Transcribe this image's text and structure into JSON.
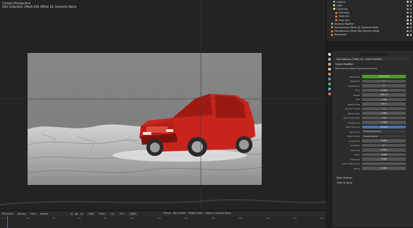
{
  "viewport": {
    "mode": "Camera Perspective",
    "subtitle": "(44) Collection | Mesh.001 Offset 16, Semente Noise"
  },
  "timeline": {
    "menus": [
      "Playback",
      "Keying",
      "View",
      "Marker"
    ],
    "start_label": "Start",
    "start_value": "1",
    "end_label": "End",
    "end_value": "250",
    "current_frame": "44",
    "ticks": [
      "0",
      "20",
      "40",
      "60",
      "80",
      "100",
      "120",
      "140",
      "160",
      "180",
      "200",
      "220",
      "240"
    ]
  },
  "status": {
    "items": [
      "Select",
      "Box Select",
      "Rotate View",
      "Object Context Menu"
    ]
  },
  "outliner": {
    "rows": [
      {
        "indent": 2,
        "label": "Camera",
        "color": "#7aa0c8"
      },
      {
        "indent": 2,
        "label": "Light",
        "color": "#e0c060"
      },
      {
        "indent": 2,
        "label": "Collection",
        "color": "#d8d8d8"
      },
      {
        "indent": 3,
        "label": "Esquerdo",
        "color": "#e07a2b"
      },
      {
        "indent": 3,
        "label": "Mesh.001",
        "color": "#e07a2b"
      },
      {
        "indent": 3,
        "label": "Mesh.002",
        "color": "#e07a2b"
      },
      {
        "indent": 1,
        "label": "Displace Modifier",
        "color": "#7aa0c8"
      },
      {
        "indent": 1,
        "label": "Mountainous Offset 16, Semente Noise",
        "color": "#e07a2b"
      },
      {
        "indent": 1,
        "label": "Mountainous Offset 16g Semente Noise",
        "color": "#e07a2b"
      },
      {
        "indent": 1,
        "label": "Rockscape",
        "color": "#e07a2b"
      }
    ]
  },
  "properties": {
    "breadcrumb": "Mountainous_Offset_16 › Ocean Modifier",
    "modifier_dropdown": "Ocean Modifier",
    "object_name": "Mountainous Offset 16g Semente Noise",
    "fields": [
      {
        "label": "Geometry",
        "value": "Generate"
      },
      {
        "label": "Repeat X",
        "value": "1"
      },
      {
        "label": "Resolution",
        "value": "7"
      },
      {
        "label": "Time",
        "value": "1.000"
      },
      {
        "label": "Depth",
        "value": "200 m"
      },
      {
        "label": "Size",
        "value": "1.000"
      },
      {
        "label": "Spatial Size",
        "value": "50 m"
      },
      {
        "label": "Random Seed",
        "value": "0"
      },
      {
        "label": "Wave Scale",
        "value": "1.000"
      },
      {
        "label": "Wave Scale Min",
        "value": "0 m"
      },
      {
        "label": "Choppiness",
        "value": "1.000"
      },
      {
        "label": "Wind Velocity",
        "value": "30 m/s"
      },
      {
        "label": "Spectrum",
        "value": "Turbulent Ocean"
      },
      {
        "label": "Bake Folder",
        "value": "Ocean Cache"
      },
      {
        "label": "Alignment",
        "value": "0.000"
      },
      {
        "label": "Direction",
        "value": "0°"
      },
      {
        "label": "Damping",
        "value": "0.500"
      },
      {
        "label": "Foam",
        "value": "0.000"
      },
      {
        "label": "Coverage",
        "value": "0.000"
      },
      {
        "label": "Foam Data Layer",
        "value": ""
      },
      {
        "label": "Spray",
        "value": "0.000"
      }
    ],
    "sections": [
      "Bake Settings",
      "Foam & Spray"
    ]
  },
  "colors": {
    "car": "#c8241c",
    "terrain": "#bfbfbf",
    "accent_green": "#4c9a2a",
    "accent_blue": "#4772b3"
  }
}
